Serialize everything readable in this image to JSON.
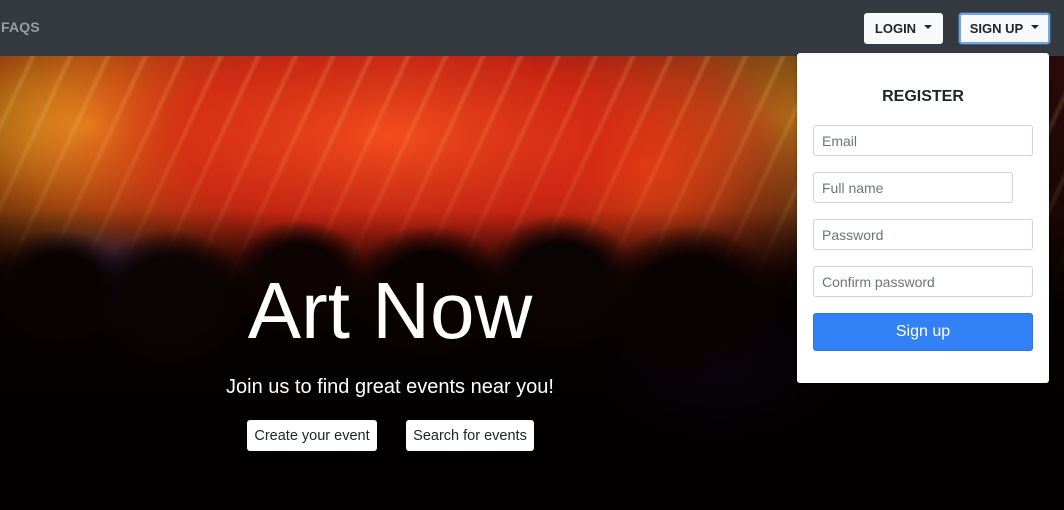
{
  "navbar": {
    "faqs_label": "FAQS",
    "login_label": "LOGIN",
    "signup_label": "SIGN UP"
  },
  "hero": {
    "title": "Art Now",
    "subtitle": "Join us to find great events near you!",
    "create_event_label": "Create your event",
    "search_events_label": "Search for events"
  },
  "register": {
    "heading": "REGISTER",
    "email_placeholder": "Email",
    "fullname_placeholder": "Full name",
    "password_placeholder": "Password",
    "confirm_placeholder": "Confirm password",
    "submit_label": "Sign up"
  },
  "colors": {
    "navbar_bg": "#343a40",
    "primary": "#3381f7",
    "light_button": "#f8f9fa"
  }
}
